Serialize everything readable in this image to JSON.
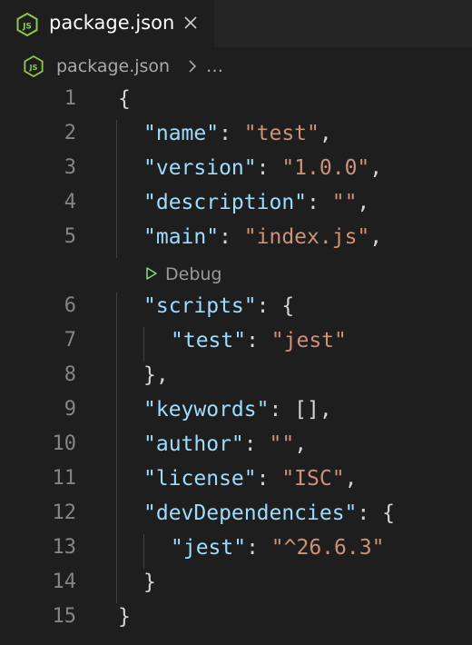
{
  "tab": {
    "label": "package.json",
    "icon": "nodejs-icon",
    "close_glyph": "×"
  },
  "breadcrumb": {
    "file": "package.json",
    "more": "…"
  },
  "codelens": {
    "label": "Debug"
  },
  "colors": {
    "background": "#1e1e1e",
    "key": "#9cdcfe",
    "string": "#ce9178",
    "punctuation": "#d4d4d4",
    "line_number": "#858585",
    "node_green": "#8cc84b"
  },
  "lines": [
    {
      "n": "1",
      "tokens": [
        {
          "t": "{",
          "c": "p"
        }
      ]
    },
    {
      "n": "2",
      "tokens": [
        {
          "t": "\"name\"",
          "c": "k"
        },
        {
          "t": ": ",
          "c": "p"
        },
        {
          "t": "\"test\"",
          "c": "s"
        },
        {
          "t": ",",
          "c": "p"
        }
      ]
    },
    {
      "n": "3",
      "tokens": [
        {
          "t": "\"version\"",
          "c": "k"
        },
        {
          "t": ": ",
          "c": "p"
        },
        {
          "t": "\"1.0.0\"",
          "c": "s"
        },
        {
          "t": ",",
          "c": "p"
        }
      ]
    },
    {
      "n": "4",
      "tokens": [
        {
          "t": "\"description\"",
          "c": "k"
        },
        {
          "t": ": ",
          "c": "p"
        },
        {
          "t": "\"\"",
          "c": "s"
        },
        {
          "t": ",",
          "c": "p"
        }
      ]
    },
    {
      "n": "5",
      "tokens": [
        {
          "t": "\"main\"",
          "c": "k"
        },
        {
          "t": ": ",
          "c": "p"
        },
        {
          "t": "\"index.js\"",
          "c": "s"
        },
        {
          "t": ",",
          "c": "p"
        }
      ]
    },
    {
      "n": "6",
      "tokens": [
        {
          "t": "\"scripts\"",
          "c": "k"
        },
        {
          "t": ": {",
          "c": "p"
        }
      ]
    },
    {
      "n": "7",
      "tokens": [
        {
          "t": "\"test\"",
          "c": "k"
        },
        {
          "t": ": ",
          "c": "p"
        },
        {
          "t": "\"jest\"",
          "c": "s"
        }
      ]
    },
    {
      "n": "8",
      "tokens": [
        {
          "t": "},",
          "c": "p"
        }
      ]
    },
    {
      "n": "9",
      "tokens": [
        {
          "t": "\"keywords\"",
          "c": "k"
        },
        {
          "t": ": [],",
          "c": "p"
        }
      ]
    },
    {
      "n": "10",
      "tokens": [
        {
          "t": "\"author\"",
          "c": "k"
        },
        {
          "t": ": ",
          "c": "p"
        },
        {
          "t": "\"\"",
          "c": "s"
        },
        {
          "t": ",",
          "c": "p"
        }
      ]
    },
    {
      "n": "11",
      "tokens": [
        {
          "t": "\"license\"",
          "c": "k"
        },
        {
          "t": ": ",
          "c": "p"
        },
        {
          "t": "\"ISC\"",
          "c": "s"
        },
        {
          "t": ",",
          "c": "p"
        }
      ]
    },
    {
      "n": "12",
      "tokens": [
        {
          "t": "\"devDependencies\"",
          "c": "k"
        },
        {
          "t": ": {",
          "c": "p"
        }
      ]
    },
    {
      "n": "13",
      "tokens": [
        {
          "t": "\"jest\"",
          "c": "k"
        },
        {
          "t": ": ",
          "c": "p"
        },
        {
          "t": "\"^26.6.3\"",
          "c": "s"
        }
      ]
    },
    {
      "n": "14",
      "tokens": [
        {
          "t": "}",
          "c": "p"
        }
      ]
    },
    {
      "n": "15",
      "tokens": [
        {
          "t": "}",
          "c": "p"
        }
      ]
    }
  ]
}
